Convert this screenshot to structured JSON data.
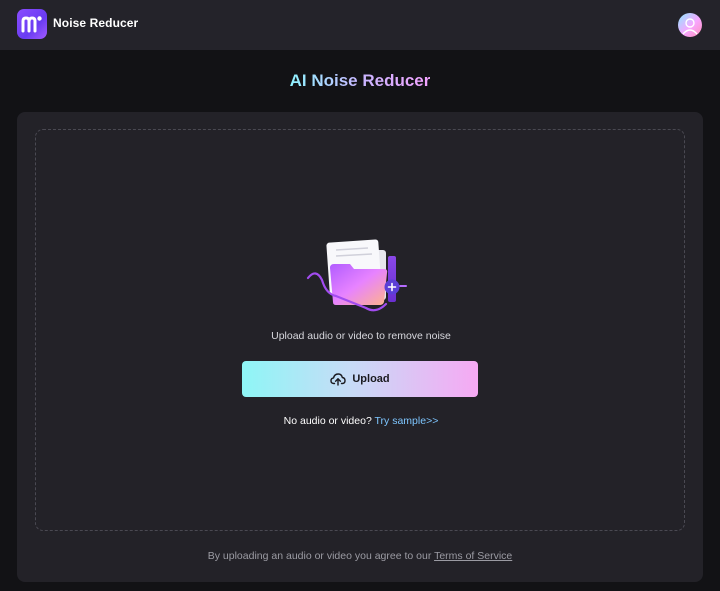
{
  "header": {
    "app_name": "Noise Reducer",
    "logo_icon": "m-logo-icon",
    "avatar_icon": "user-avatar-icon"
  },
  "main": {
    "title": "AI Noise Reducer",
    "upload": {
      "hint": "Upload audio or video to remove noise",
      "button_label": "Upload",
      "button_icon": "cloud-upload-icon",
      "sample_prefix": "No audio or video?",
      "sample_link": "Try sample>>"
    },
    "footer": {
      "note_prefix": "By uploading an audio or video you agree to our",
      "tos_link": "Terms of Service"
    }
  },
  "colors": {
    "background": "#121215",
    "header_bg": "#24232a",
    "panel_bg": "#232228",
    "accent_cyan": "#8ef6f6",
    "accent_pink": "#f6a9f3",
    "link": "#7ec6ff",
    "logo_purple": "#7c45f7"
  }
}
